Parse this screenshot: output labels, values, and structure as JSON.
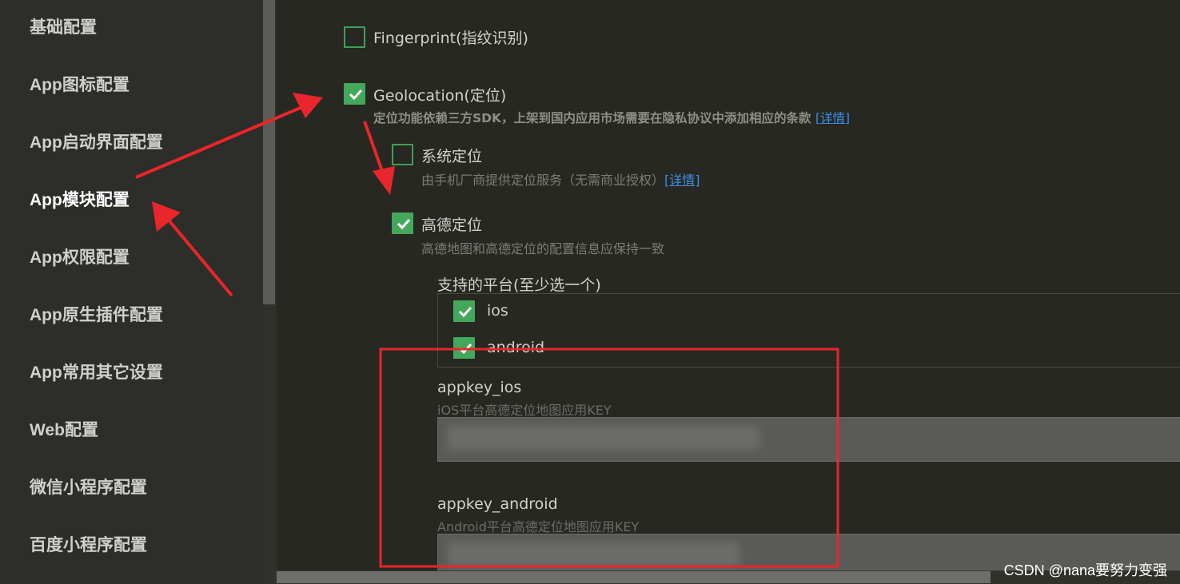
{
  "sidebar": {
    "items": [
      {
        "label": "基础配置"
      },
      {
        "label": "App图标配置"
      },
      {
        "label": "App启动界面配置"
      },
      {
        "label": "App模块配置"
      },
      {
        "label": "App权限配置"
      },
      {
        "label": "App原生插件配置"
      },
      {
        "label": "App常用其它设置"
      },
      {
        "label": "Web配置"
      },
      {
        "label": "微信小程序配置"
      },
      {
        "label": "百度小程序配置"
      }
    ],
    "active": "App模块配置"
  },
  "modules": {
    "fingerprint": {
      "label": "Fingerprint(指纹识别)",
      "checked": false
    },
    "geolocation": {
      "label": "Geolocation(定位)",
      "checked": true,
      "desc": "定位功能依赖三方SDK，上架到国内应用市场需要在隐私协议中添加相应的条款",
      "link": "[详情]"
    },
    "system_location": {
      "label": "系统定位",
      "checked": false,
      "desc": "由手机厂商提供定位服务（无需商业授权）",
      "link": "[详情]"
    },
    "amap": {
      "label": "高德定位",
      "checked": true,
      "desc": "高德地图和高德定位的配置信息应保持一致"
    }
  },
  "platforms": {
    "title": "支持的平台(至少选一个)",
    "ios": {
      "label": "ios",
      "checked": true
    },
    "android": {
      "label": "android",
      "checked": true
    }
  },
  "appkey_ios": {
    "label": "appkey_ios",
    "desc": "iOS平台高德定位地图应用KEY"
  },
  "appkey_android": {
    "label": "appkey_android",
    "desc": "Android平台高德定位地图应用KEY"
  },
  "watermark": "CSDN @nana要努力变强",
  "colors": {
    "background": "#272822",
    "sidebar": "#2d2d29",
    "checkbox_green": "#43a85b",
    "link": "#3d8ee6",
    "annotation_red": "#e8262b"
  }
}
